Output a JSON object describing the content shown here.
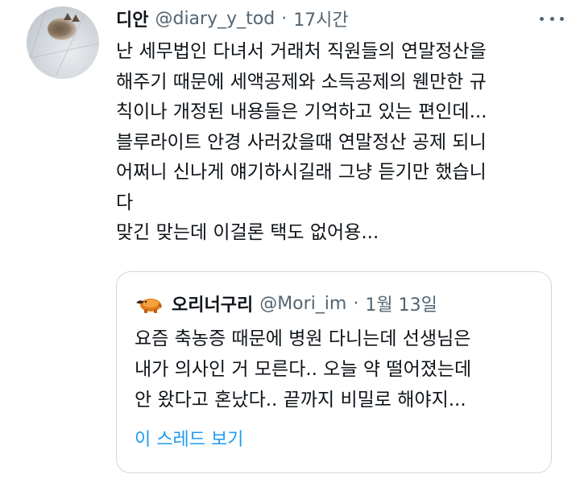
{
  "tweet": {
    "author": {
      "name": "디안",
      "handle": "@diary_y_tod",
      "avatar_icon": "cat-avatar-icon"
    },
    "separator": "·",
    "time": "17시간",
    "more_icon": "more-dots-icon",
    "text_lines": [
      "난 세무법인 다녀서 거래처 직원들의 연말정산을",
      "해주기 때문에 세액공제와 소득공제의 웬만한 규",
      "칙이나 개정된 내용들은 기억하고 있는 편인데...",
      "블루라이트 안경 사러갔을때 연말정산 공제 되니",
      "어쩌니 신나게 얘기하시길래 그냥 듣기만 했습니",
      "다",
      "맞긴 맞는데 이걸론 택도 없어용..."
    ],
    "quoted": {
      "author": {
        "name": "오리너구리",
        "handle": "@Mori_im",
        "avatar_icon": "platypus-avatar-icon"
      },
      "separator": "·",
      "time": "1월 13일",
      "text_lines": [
        "요즘 축농증 때문에 병원 다니는데 선생님은",
        "내가 의사인 거 모른다.. 오늘 약 떨어졌는데",
        "안 왔다고 혼났다.. 끝까지 비밀로 해야지..."
      ],
      "show_thread_label": "이 스레드 보기"
    },
    "colors": {
      "text": "#0f1419",
      "secondary": "#536471",
      "link": "#1d9bf0",
      "border": "#cfd9de"
    }
  }
}
